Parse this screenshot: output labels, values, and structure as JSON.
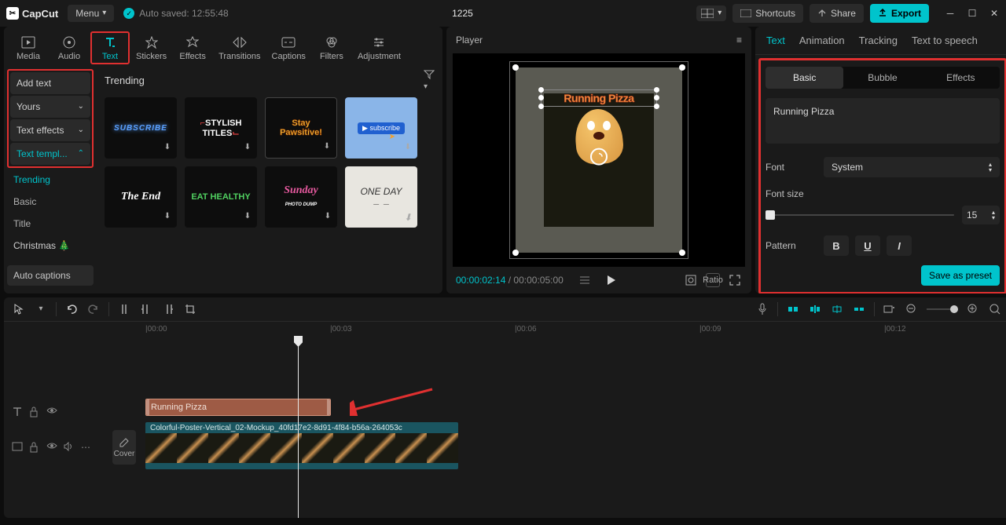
{
  "titlebar": {
    "app_name": "CapCut",
    "menu_label": "Menu",
    "autosaved": "Auto saved: 12:55:48",
    "project_title": "1225",
    "shortcuts": "Shortcuts",
    "share": "Share",
    "export": "Export"
  },
  "media_tabs": [
    "Media",
    "Audio",
    "Text",
    "Stickers",
    "Effects",
    "Transitions",
    "Captions",
    "Filters",
    "Adjustment"
  ],
  "media_tabs_active": "Text",
  "sidebar": {
    "items": [
      {
        "label": "Add text",
        "expand": false
      },
      {
        "label": "Yours",
        "expand": true
      },
      {
        "label": "Text effects",
        "expand": true
      },
      {
        "label": "Text templ...",
        "expand": true,
        "active": true
      }
    ],
    "subs": [
      {
        "label": "Trending",
        "active": true
      },
      {
        "label": "Basic"
      },
      {
        "label": "Title"
      },
      {
        "label": "Christmas 🎄"
      }
    ],
    "auto_captions": "Auto captions"
  },
  "content": {
    "heading": "Trending"
  },
  "player": {
    "title": "Player",
    "overlay_text": "Running Pizza",
    "time": "00:00:02:14",
    "duration": "00:00:05:00",
    "ratio": "Ratio"
  },
  "inspector": {
    "tabs": [
      "Text",
      "Animation",
      "Tracking",
      "Text to speech"
    ],
    "active_tab": "Text",
    "subtabs": [
      "Basic",
      "Bubble",
      "Effects"
    ],
    "active_subtab": "Basic",
    "text_value": "Running Pizza",
    "font_label": "Font",
    "font_value": "System",
    "font_size_label": "Font size",
    "font_size_value": "15",
    "pattern_label": "Pattern",
    "save_preset": "Save as preset"
  },
  "timeline": {
    "ticks": [
      "|00:00",
      "|00:03",
      "|00:06",
      "|00:09",
      "|00:12"
    ],
    "cover_label": "Cover",
    "text_clip": "Running Pizza",
    "video_clip": "Colorful-Poster-Vertical_02-Mockup_40fd17e2-8d91-4f84-b56a-264053c"
  }
}
